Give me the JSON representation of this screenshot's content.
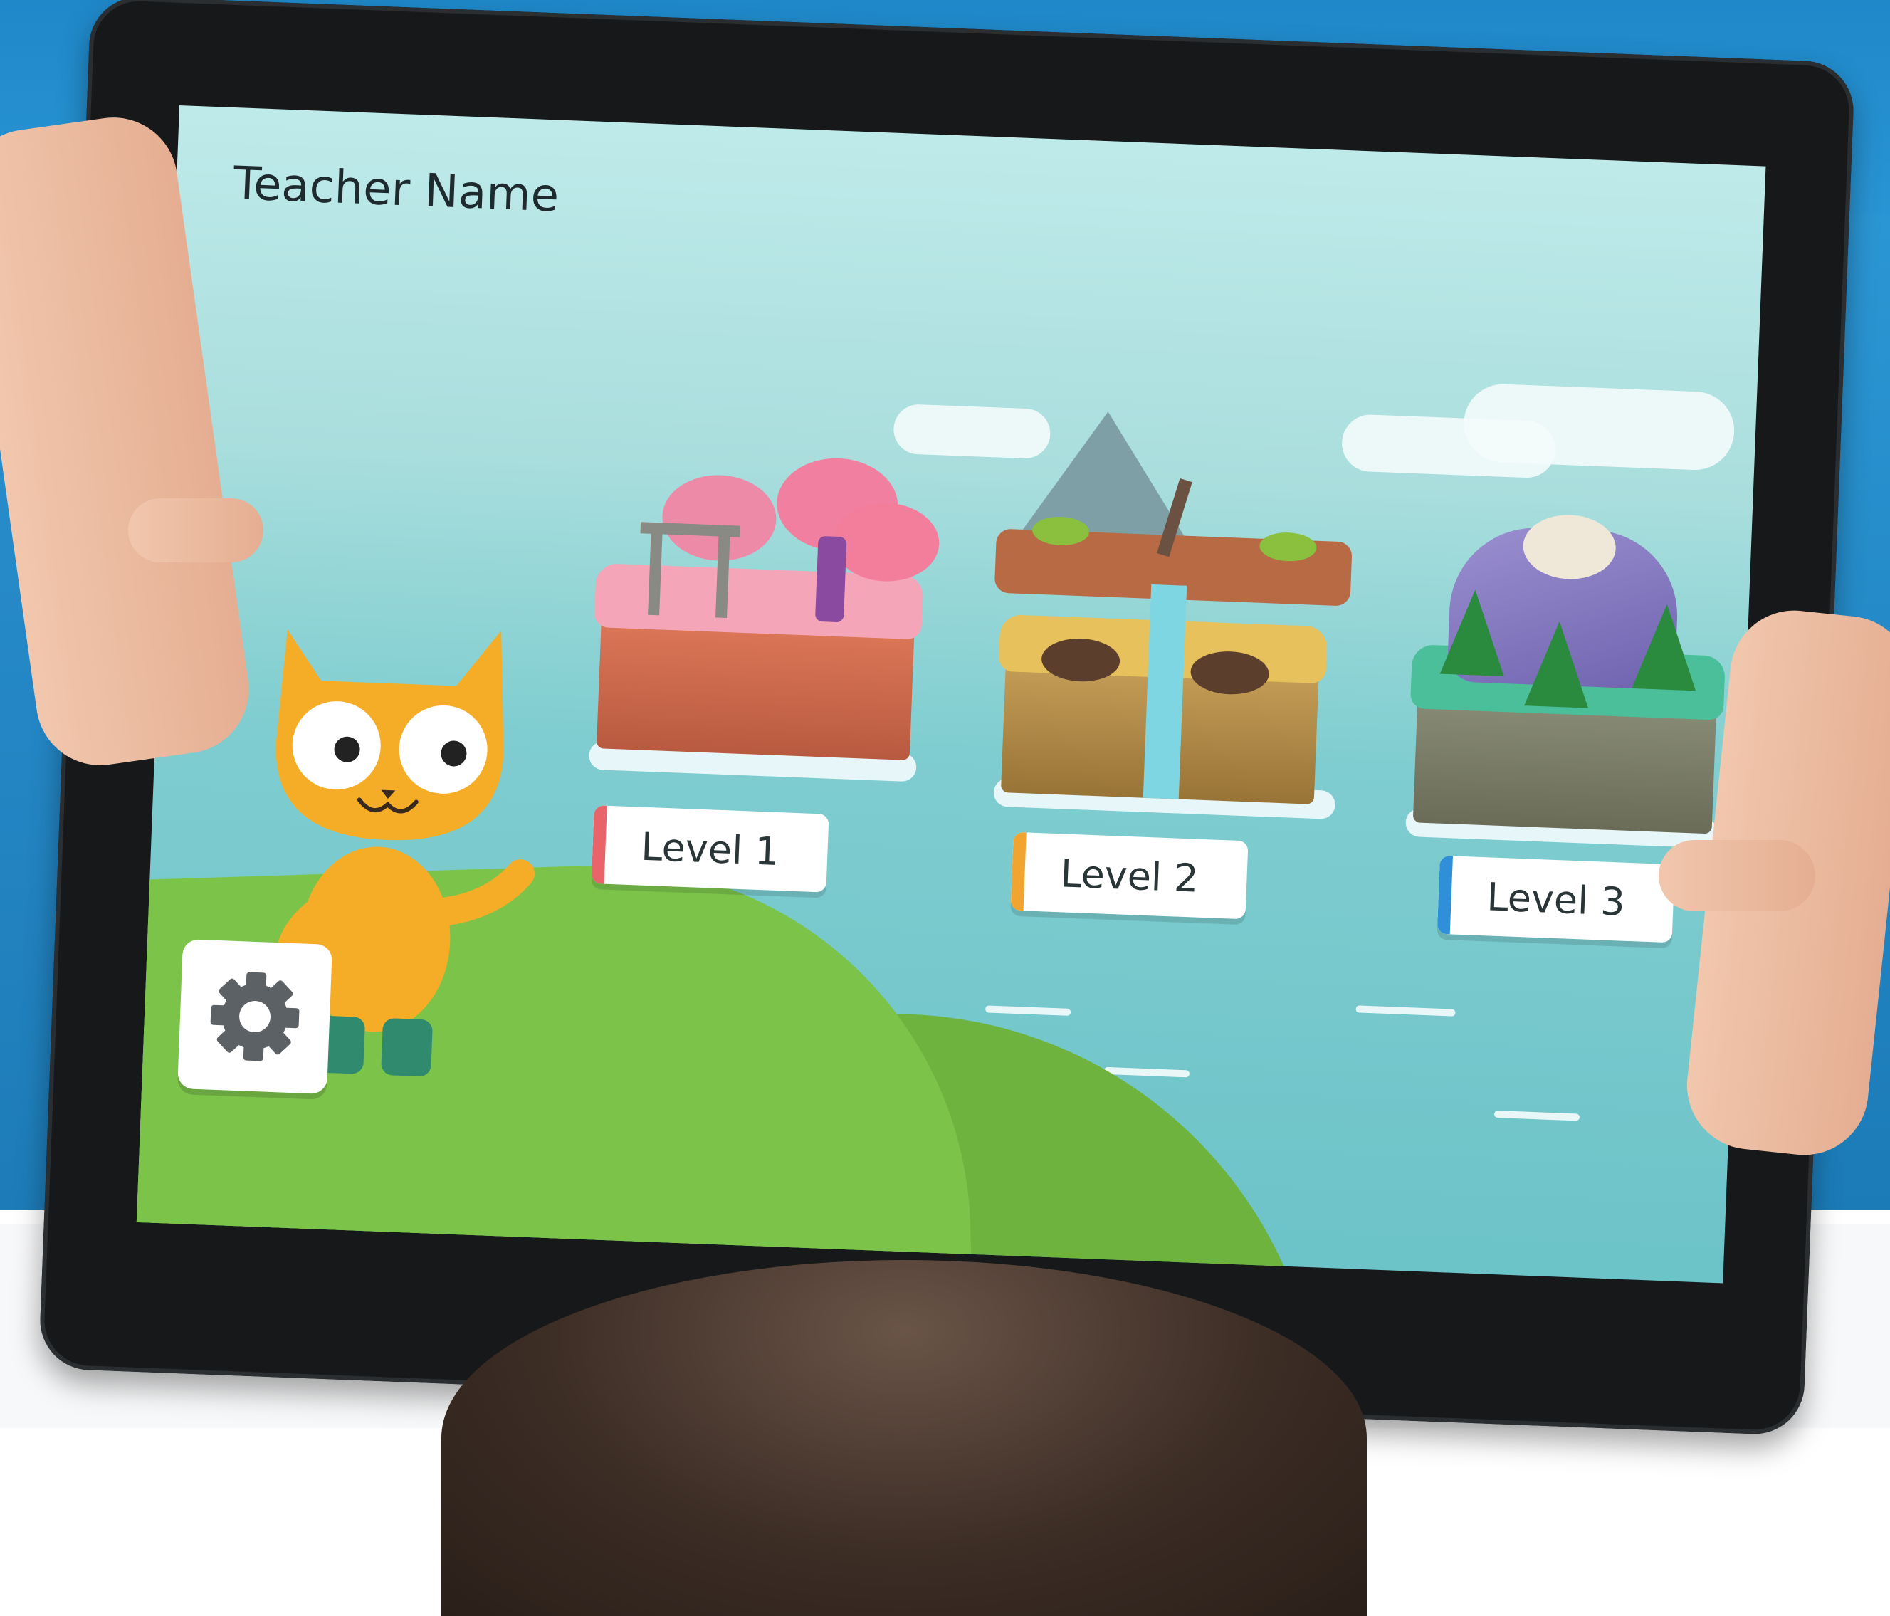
{
  "screen": {
    "header": {
      "teacher_name": "Teacher Name"
    },
    "levels": [
      {
        "label": "Level 1",
        "accent_color": "#e9636b"
      },
      {
        "label": "Level 2",
        "accent_color": "#f2a431"
      },
      {
        "label": "Level 3",
        "accent_color": "#2f8fd8"
      }
    ],
    "settings": {
      "icon": "gear-icon"
    },
    "mascot": {
      "icon": "cat-mascot"
    }
  },
  "colors": {
    "sky": "#a9dedd",
    "grass": "#7cc34a",
    "cat": "#f5ad27",
    "bezel": "#16181a"
  }
}
